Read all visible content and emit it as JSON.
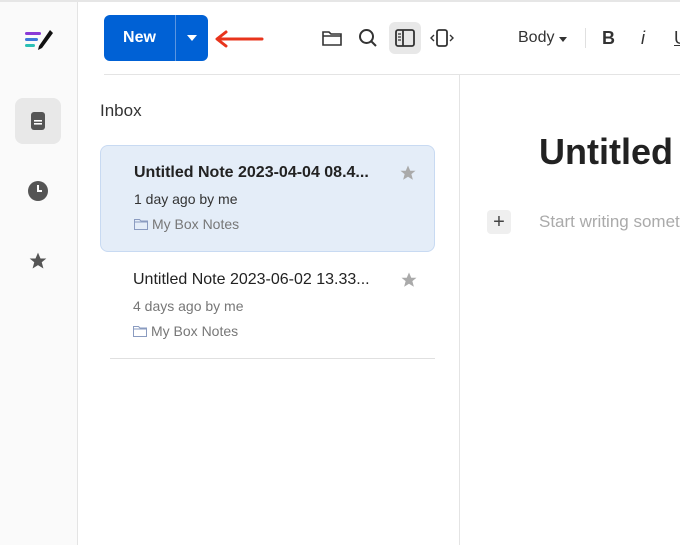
{
  "toolbar": {
    "new_label": "New",
    "style_select": "Body",
    "bold": "B",
    "italic": "i",
    "underline": "U"
  },
  "list": {
    "heading": "Inbox",
    "notes": [
      {
        "title": "Untitled Note 2023-04-04 08.4...",
        "meta": "1 day ago by me",
        "folder": "My Box Notes",
        "selected": true
      },
      {
        "title": "Untitled Note 2023-06-02 13.33...",
        "meta": "4 days ago by me",
        "folder": "My Box Notes",
        "selected": false
      }
    ]
  },
  "editor": {
    "title": "Untitled",
    "placeholder": "Start writing something"
  },
  "colors": {
    "accent": "#0061d5",
    "arrow": "#e8341c",
    "selected_bg": "#e4edf8"
  }
}
